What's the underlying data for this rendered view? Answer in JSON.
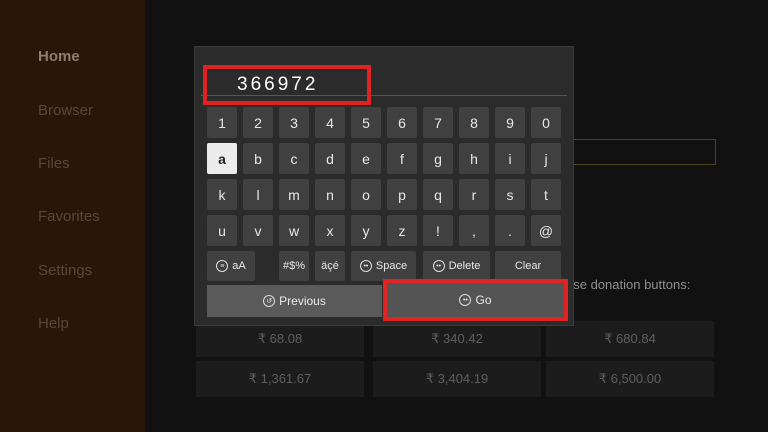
{
  "sidebar": {
    "items": [
      {
        "label": "Home"
      },
      {
        "label": "Browser"
      },
      {
        "label": "Files"
      },
      {
        "label": "Favorites"
      },
      {
        "label": "Settings"
      },
      {
        "label": "Help"
      }
    ]
  },
  "background": {
    "donation_prompt": "ase donation buttons:",
    "donation_prompt2": ")",
    "donations": [
      "₹ 68.08",
      "₹ 340.42",
      "₹ 680.84",
      "₹ 1,361.67",
      "₹ 3,404.19",
      "₹ 6,500.00"
    ]
  },
  "keyboard": {
    "input_value": "366972",
    "rows": [
      [
        "1",
        "2",
        "3",
        "4",
        "5",
        "6",
        "7",
        "8",
        "9",
        "0"
      ],
      [
        "a",
        "b",
        "c",
        "d",
        "e",
        "f",
        "g",
        "h",
        "i",
        "j"
      ],
      [
        "k",
        "l",
        "m",
        "n",
        "o",
        "p",
        "q",
        "r",
        "s",
        "t"
      ],
      [
        "u",
        "v",
        "w",
        "x",
        "y",
        "z",
        "!",
        ",",
        ".",
        "@"
      ]
    ],
    "focused_key": "a",
    "function_keys": [
      {
        "label": "aA",
        "icon": "cycle-icon"
      },
      {
        "label": "#$%"
      },
      {
        "label": "äçé"
      },
      {
        "label": "Space",
        "icon": "button-icon"
      },
      {
        "label": "Delete",
        "icon": "button-icon"
      },
      {
        "label": "Clear"
      }
    ],
    "previous_label": "Previous",
    "go_label": "Go"
  },
  "colors": {
    "highlight_red": "#e02222",
    "sidebar_bg": "#2a1609"
  }
}
